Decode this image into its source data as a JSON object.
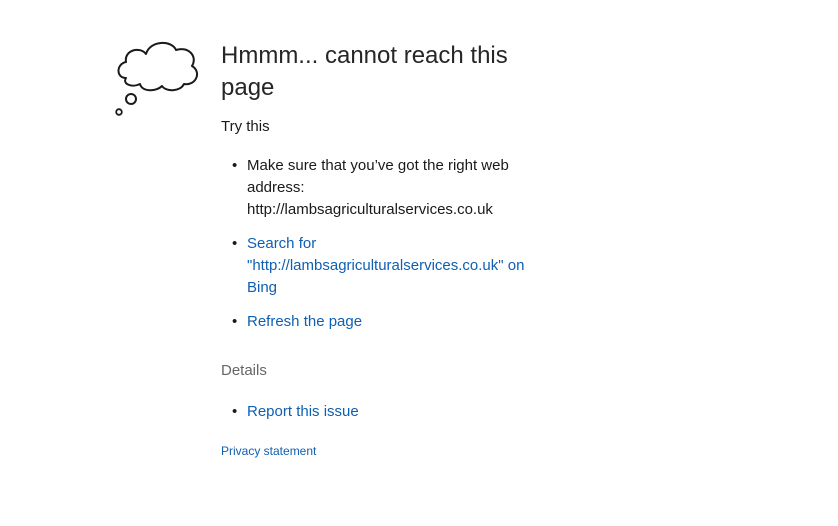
{
  "error": {
    "heading": "Hmmm... cannot reach this page",
    "try_this": "Try this",
    "suggestions": [
      {
        "text": "Make sure that you’ve got the right web address: http://lambsagriculturalservices.co.uk"
      },
      {
        "link": "Search for \"http://lambsagriculturalservices.co.uk\" on Bing"
      },
      {
        "link": "Refresh the page"
      }
    ],
    "details_label": "Details",
    "report_link": "Report this issue",
    "privacy_link": "Privacy statement"
  },
  "colors": {
    "link": "#0f5fb3",
    "text": "#1a1a1a",
    "muted": "#666666"
  },
  "icons": {
    "illustration": "thought-bubble-icon",
    "bullet": "bullet-dot"
  }
}
